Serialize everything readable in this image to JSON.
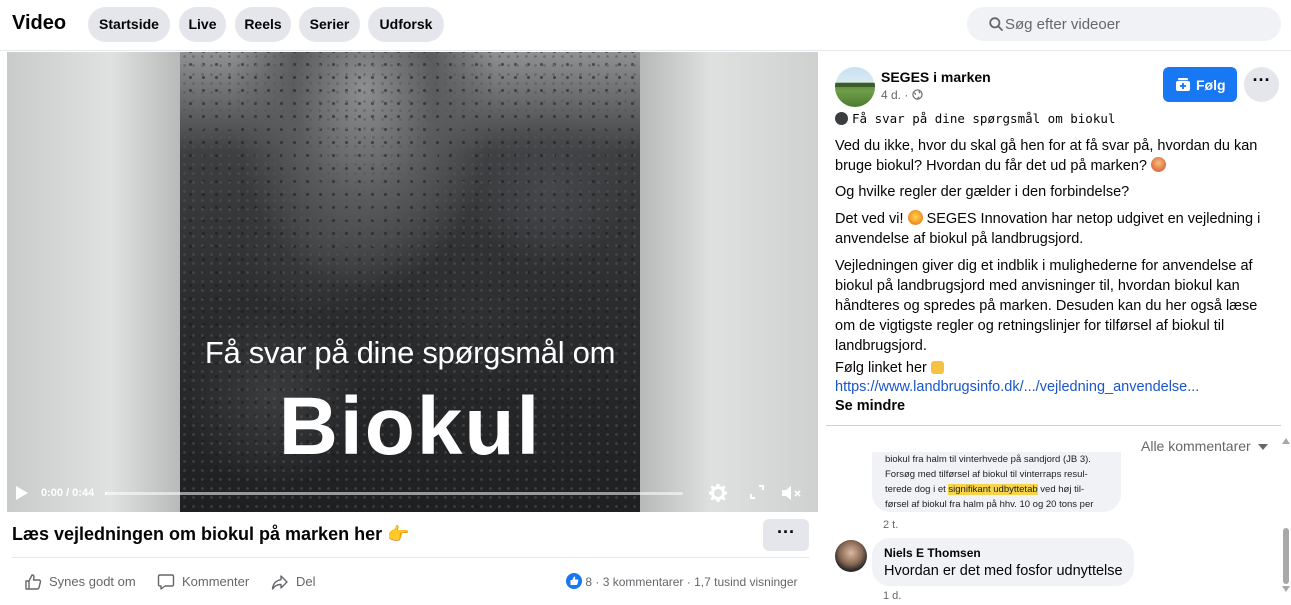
{
  "header": {
    "title": "Video",
    "tabs": [
      "Startside",
      "Live",
      "Reels",
      "Serier",
      "Udforsk"
    ],
    "search_placeholder": "Søg efter videoer"
  },
  "video": {
    "overlay_subtitle": "Få svar på dine spørgsmål om",
    "overlay_title": "Biokul",
    "time": "0:00 / 0:44",
    "progress": 0.0
  },
  "post": {
    "heading": "Læs vejledningen om biokul på marken her 👉",
    "more_label": "···",
    "actions": {
      "like": "Synes godt om",
      "comment": "Kommenter",
      "share": "Del"
    },
    "stats": {
      "likes": "8",
      "comments": "3 kommentarer",
      "views": "1,7 tusind visninger"
    }
  },
  "sidebar": {
    "page_name": "SEGES i marken",
    "meta": "4 d. ·",
    "follow_label": "Følg",
    "options_label": "···",
    "mono_line": "Få svar på dine spørgsmål om biokul",
    "paragraphs": [
      "Ved du ikke, hvor du skal gå hen for at få svar på, hvordan du kan bruge biokul? Hvordan du får det ud på marken?",
      "Og hvilke regler der gælder i den forbindelse?",
      "Det ved vi!",
      "SEGES Innovation har netop udgivet en vejledning i anvendelse af biokul på landbrugsjord.",
      "Vejledningen giver dig et indblik i mulighederne for anvendelse af biokul på landbrugsjord med anvisninger til, hvordan biokul kan håndteres og spredes på marken. Desuden kan du her også læse om de vigtigste regler og retningslinjer for tilførsel af biokul til landbrugsjord.",
      "Følg linket her"
    ],
    "link": "https://www.landbrugsinfo.dk/.../vejledning_anvendelse...",
    "see_less": "Se mindre",
    "comments_sort": "Alle kommentarer",
    "comments": [
      {
        "image_lines": [
          "biokul fra halm til vinterhvede på sandjord (JB 3).",
          "Forsøg med tilførsel af biokul til vinterraps resul-",
          "terede dog i et ",
          "signifikant udbyttetab",
          " ved høj til-",
          "førsel af biokul fra halm på hhv. 10 og 20 tons per"
        ],
        "time": "2 t."
      },
      {
        "author": "Niels E Thomsen",
        "text": "Hvordan er det med fosfor udnyttelse",
        "time": "1 d."
      }
    ]
  },
  "colors": {
    "accent": "#1877f2",
    "chip_bg": "#e4e6eb",
    "muted_text": "#65676b",
    "link": "#1a56c8",
    "highlight": "#f7d54a"
  }
}
